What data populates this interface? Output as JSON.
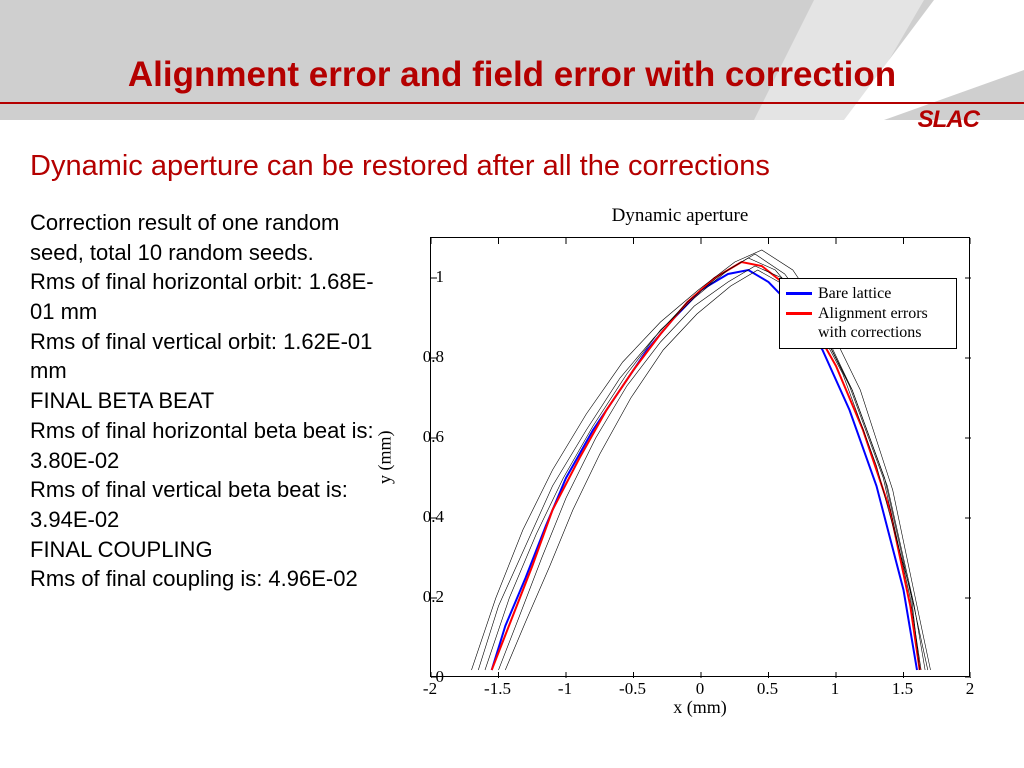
{
  "title": "Alignment error and field error with correction",
  "subtitle": "Dynamic aperture can be restored after all the corrections",
  "logo": "SLAC",
  "body_lines": [
    "Correction result of one random seed, total 10 random seeds.",
    "Rms of final horizontal orbit: 1.68E-01 mm",
    "Rms of final vertical orbit: 1.62E-01 mm",
    "FINAL BETA BEAT",
    "Rms of final horizontal beta beat is: 3.80E-02",
    "Rms of final vertical beta beat is: 3.94E-02",
    "FINAL COUPLING",
    "Rms of final coupling is: 4.96E-02"
  ],
  "chart_data": {
    "type": "line",
    "title": "Dynamic aperture",
    "xlabel": "x (mm)",
    "ylabel": "y (mm)",
    "xlim": [
      -2,
      2
    ],
    "ylim": [
      0,
      1.1
    ],
    "xticks": [
      -2,
      -1.5,
      -1,
      -0.5,
      0,
      0.5,
      1,
      1.5,
      2
    ],
    "yticks": [
      0,
      0.2,
      0.4,
      0.6,
      0.8,
      1
    ],
    "legend": {
      "position": "top-right",
      "entries": [
        {
          "name": "Bare lattice",
          "color": "#0000ff",
          "width": 2
        },
        {
          "name": "Alignment errors with corrections",
          "color": "#ff0000",
          "width": 2
        }
      ]
    },
    "series": [
      {
        "name": "Bare lattice",
        "color": "#0000ff",
        "width": 2,
        "x": [
          -1.55,
          -1.45,
          -1.3,
          -1.15,
          -1.0,
          -0.8,
          -0.6,
          -0.4,
          -0.2,
          0.0,
          0.2,
          0.35,
          0.5,
          0.7,
          0.9,
          1.1,
          1.3,
          1.5,
          1.6
        ],
        "y": [
          0.02,
          0.13,
          0.25,
          0.38,
          0.5,
          0.62,
          0.72,
          0.82,
          0.9,
          0.97,
          1.01,
          1.02,
          0.99,
          0.92,
          0.82,
          0.67,
          0.48,
          0.22,
          0.02
        ]
      },
      {
        "name": "Alignment errors with corrections",
        "color": "#ff0000",
        "width": 2,
        "x": [
          -1.55,
          -1.4,
          -1.25,
          -1.1,
          -0.9,
          -0.7,
          -0.5,
          -0.3,
          -0.1,
          0.1,
          0.3,
          0.45,
          0.6,
          0.8,
          1.0,
          1.2,
          1.4,
          1.55,
          1.62
        ],
        "y": [
          0.02,
          0.15,
          0.28,
          0.42,
          0.55,
          0.67,
          0.77,
          0.86,
          0.94,
          1.0,
          1.04,
          1.03,
          0.99,
          0.9,
          0.78,
          0.62,
          0.42,
          0.18,
          0.02
        ]
      },
      {
        "name": "seed1",
        "color": "#000000",
        "width": 0.6,
        "x": [
          -1.65,
          -1.5,
          -1.3,
          -1.1,
          -0.85,
          -0.6,
          -0.35,
          -0.1,
          0.15,
          0.35,
          0.55,
          0.8,
          1.05,
          1.3,
          1.55,
          1.68
        ],
        "y": [
          0.02,
          0.18,
          0.33,
          0.48,
          0.62,
          0.75,
          0.85,
          0.94,
          1.01,
          1.05,
          1.02,
          0.92,
          0.76,
          0.53,
          0.22,
          0.02
        ]
      },
      {
        "name": "seed2",
        "color": "#000000",
        "width": 0.6,
        "x": [
          -1.5,
          -1.35,
          -1.18,
          -1.0,
          -0.78,
          -0.55,
          -0.3,
          -0.05,
          0.2,
          0.4,
          0.6,
          0.85,
          1.1,
          1.35,
          1.55,
          1.63
        ],
        "y": [
          0.02,
          0.15,
          0.3,
          0.45,
          0.6,
          0.73,
          0.84,
          0.93,
          0.99,
          1.03,
          1.0,
          0.9,
          0.73,
          0.5,
          0.2,
          0.02
        ]
      },
      {
        "name": "seed3",
        "color": "#000000",
        "width": 0.6,
        "x": [
          -1.6,
          -1.42,
          -1.22,
          -1.02,
          -0.8,
          -0.55,
          -0.3,
          -0.05,
          0.2,
          0.4,
          0.62,
          0.88,
          1.12,
          1.38,
          1.58,
          1.66
        ],
        "y": [
          0.02,
          0.2,
          0.36,
          0.5,
          0.63,
          0.76,
          0.87,
          0.95,
          1.02,
          1.06,
          1.01,
          0.89,
          0.72,
          0.48,
          0.18,
          0.02
        ]
      },
      {
        "name": "seed4",
        "color": "#000000",
        "width": 0.6,
        "x": [
          -1.45,
          -1.3,
          -1.12,
          -0.95,
          -0.75,
          -0.52,
          -0.28,
          -0.03,
          0.22,
          0.42,
          0.63,
          0.88,
          1.12,
          1.36,
          1.56,
          1.62
        ],
        "y": [
          0.02,
          0.14,
          0.28,
          0.42,
          0.56,
          0.7,
          0.82,
          0.91,
          0.98,
          1.02,
          0.98,
          0.88,
          0.72,
          0.5,
          0.2,
          0.02
        ]
      },
      {
        "name": "seed5",
        "color": "#000000",
        "width": 0.6,
        "x": [
          -1.7,
          -1.52,
          -1.32,
          -1.1,
          -0.85,
          -0.58,
          -0.3,
          -0.02,
          0.25,
          0.45,
          0.68,
          0.92,
          1.18,
          1.42,
          1.6,
          1.7
        ],
        "y": [
          0.02,
          0.2,
          0.37,
          0.52,
          0.66,
          0.79,
          0.89,
          0.97,
          1.04,
          1.07,
          1.02,
          0.9,
          0.72,
          0.47,
          0.18,
          0.02
        ]
      }
    ]
  }
}
